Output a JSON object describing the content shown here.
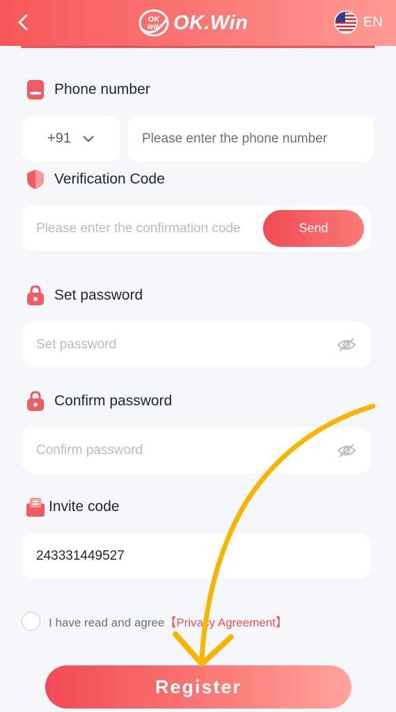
{
  "header": {
    "back_icon": "chevron-left-icon",
    "logo_badge": "OK WIN",
    "logo_text": "OK.Win",
    "language": "EN",
    "flag_icon": "us-flag-icon"
  },
  "form": {
    "phone": {
      "label": "Phone number",
      "icon": "phone-icon",
      "country_code": "+91",
      "placeholder": "Please enter the phone number"
    },
    "verification": {
      "label": "Verification Code",
      "icon": "shield-icon",
      "placeholder": "Please enter the confirmation code",
      "send_label": "Send"
    },
    "password": {
      "label": "Set password",
      "icon": "lock-icon",
      "placeholder": "Set password"
    },
    "confirm_password": {
      "label": "Confirm password",
      "icon": "lock-icon",
      "placeholder": "Confirm password"
    },
    "invite": {
      "label": "Invite code",
      "icon": "invite-icon",
      "value": "243331449527"
    },
    "agreement": {
      "text": "I have read and agree",
      "link": "【Privacy Agreement】",
      "checked": false
    },
    "register_label": "Register"
  },
  "colors": {
    "accent": "#f24a55",
    "accent_light": "#fb7a77",
    "annotation_arrow": "#f7b500"
  }
}
